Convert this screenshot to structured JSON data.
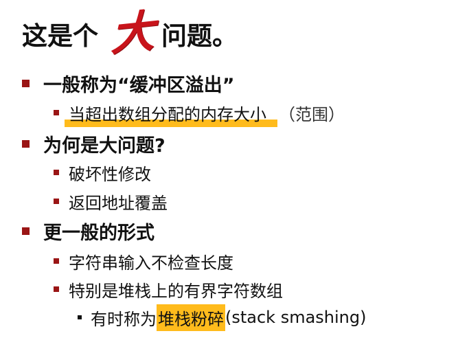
{
  "title": {
    "prefix": "这是个",
    "brush_char": "大",
    "suffix": "问题。"
  },
  "colors": {
    "bullet_accent": "#9a1515",
    "brush_red": "#c8141b",
    "highlight": "#ffbb1c"
  },
  "sections": [
    {
      "heading": "一般称为“缓冲区溢出”",
      "items": [
        {
          "highlighted": "当超出数组分配的内存大小",
          "rest": "（范围）"
        }
      ]
    },
    {
      "heading": "为何是大问题?",
      "items": [
        "破坏性修改",
        "返回地址覆盖"
      ]
    },
    {
      "heading": "更一般的形式",
      "items": [
        "字符串输入不检查长度",
        "特别是堆栈上的有界字符数组"
      ],
      "sub_item": {
        "prefix": "有时称为",
        "highlighted": "堆栈粉碎",
        "suffix": "(stack smashing)"
      }
    }
  ]
}
